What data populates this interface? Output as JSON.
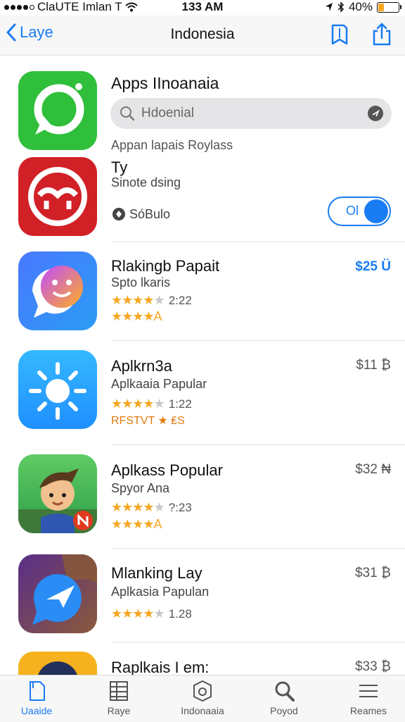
{
  "status_bar": {
    "carrier": "ClaUTE Imlan T",
    "time": "133 AM",
    "battery": "40%"
  },
  "nav": {
    "back_label": "Laye",
    "title": "Indonesia"
  },
  "header_app": {
    "title": "Apps IInoanaia",
    "search_value": "Hdoenial",
    "subtitle": "Appan lapais Roylass"
  },
  "second_app": {
    "title": "Ty",
    "subtitle": "Sinote dsing",
    "developer": "SóBulo",
    "toggle_label": "Ol"
  },
  "apps": [
    {
      "title": "Rlakingb Papait",
      "subtitle": "Spto lkaris",
      "rating": 4,
      "rating_count": "2:22",
      "extra": "★★★★A",
      "price": "$25 Ü",
      "price_style": "blue"
    },
    {
      "title": "Aplkrn3a",
      "subtitle": "Aplkaaia Papular",
      "rating": 4,
      "rating_count": "1:22",
      "extra": "RFSTVT ★ ₤S",
      "price": "$11 ₿",
      "price_style": "gray"
    },
    {
      "title": "Aplkass Popular",
      "subtitle": "Spyor Ana",
      "rating": 4,
      "rating_count": "?:23",
      "extra": "★★★★A",
      "price": "$32 ₦",
      "price_style": "gray"
    },
    {
      "title": "Mlanking Lay",
      "subtitle": "Aplkasia Papulan",
      "rating": 4,
      "rating_count": "1.28",
      "extra": "",
      "price": "$31 ₿",
      "price_style": "gray"
    },
    {
      "title": "Raplkais I em:",
      "subtitle": "",
      "rating": 0,
      "rating_count": "",
      "extra": "",
      "price": "$33 ₿",
      "price_style": "gray"
    }
  ],
  "tabs": [
    {
      "label": "Uaaide",
      "icon": "document-icon"
    },
    {
      "label": "Raye",
      "icon": "grid-icon"
    },
    {
      "label": "Indonaaia",
      "icon": "badge-icon"
    },
    {
      "label": "Poyod",
      "icon": "search-icon"
    },
    {
      "label": "Reames",
      "icon": "list-icon"
    }
  ],
  "colors": {
    "accent": "#1a7cf3",
    "star": "#f5a623",
    "bar_bg": "#f7f7f7"
  }
}
